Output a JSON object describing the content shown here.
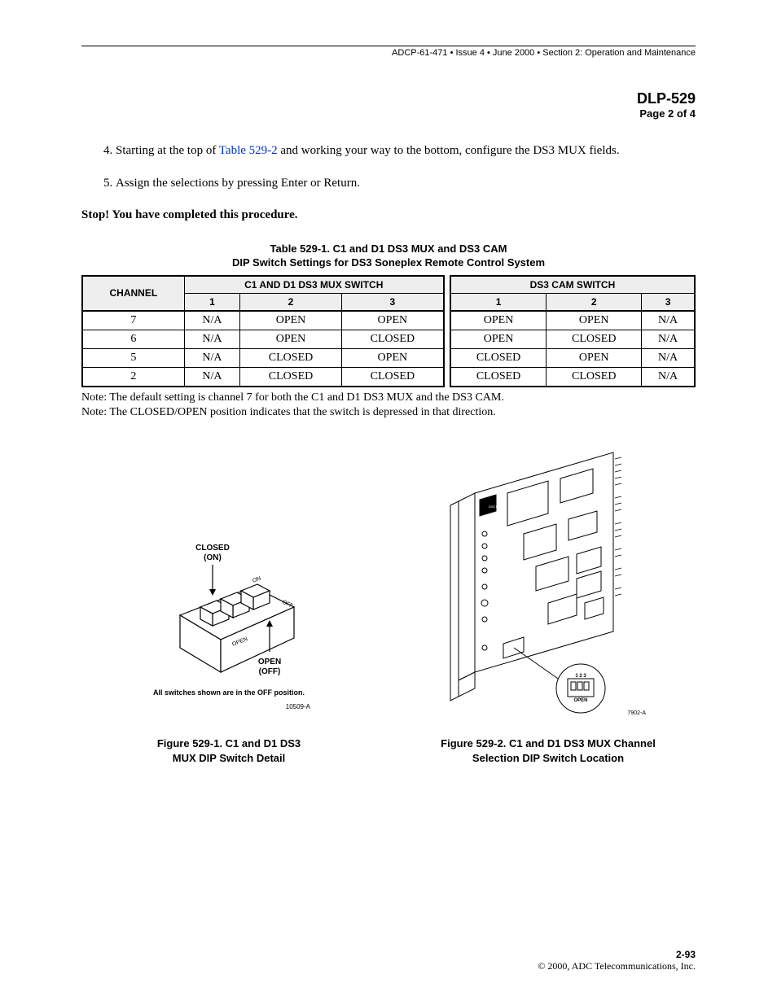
{
  "header": {
    "line": "ADCP-61-471 • Issue 4 • June 2000 • Section 2: Operation and Maintenance"
  },
  "dlp": {
    "title": "DLP-529",
    "page": "Page 2 of 4"
  },
  "steps": {
    "s4_pre": "Starting at the top of ",
    "s4_link": "Table 529-2",
    "s4_post": " and working your way to the bottom, configure the DS3 MUX fields.",
    "s5": "Assign the selections by pressing Enter or Return."
  },
  "stop": "Stop! You have completed this procedure.",
  "table": {
    "title1": "Table 529-1. C1 and D1 DS3 MUX and DS3 CAM",
    "title2": "DIP Switch Settings for DS3 Soneplex Remote Control System",
    "h_channel": "CHANNEL",
    "h_mux": "C1 AND D1 DS3 MUX SWITCH",
    "h_cam": "DS3 CAM SWITCH",
    "h1": "1",
    "h2": "2",
    "h3": "3",
    "rows": [
      {
        "ch": "7",
        "m1": "N/A",
        "m2": "OPEN",
        "m3": "OPEN",
        "c1": "OPEN",
        "c2": "OPEN",
        "c3": "N/A"
      },
      {
        "ch": "6",
        "m1": "N/A",
        "m2": "OPEN",
        "m3": "CLOSED",
        "c1": "OPEN",
        "c2": "CLOSED",
        "c3": "N/A"
      },
      {
        "ch": "5",
        "m1": "N/A",
        "m2": "CLOSED",
        "m3": "OPEN",
        "c1": "CLOSED",
        "c2": "OPEN",
        "c3": "N/A"
      },
      {
        "ch": "2",
        "m1": "N/A",
        "m2": "CLOSED",
        "m3": "CLOSED",
        "c1": "CLOSED",
        "c2": "CLOSED",
        "c3": "N/A"
      }
    ]
  },
  "notes": {
    "n1": "Note: The default setting is channel 7 for both the C1 and D1 DS3 MUX and the DS3 CAM.",
    "n2": "Note: The CLOSED/OPEN position indicates that the switch is depressed in that direction."
  },
  "fig1": {
    "closed": "CLOSED",
    "on": "(ON)",
    "open_lbl": "OPEN",
    "off": "(OFF)",
    "note": "All switches shown are in the OFF position.",
    "code": "10509-A",
    "caption1": "Figure 529-1. C1 and D1 DS3",
    "caption2": "MUX DIP Switch Detail"
  },
  "fig2": {
    "code": "7902-A",
    "caption1": "Figure 529-2. C1 and D1 DS3 MUX Channel",
    "caption2": "Selection DIP Switch Location",
    "dip_label_open": "OPEN",
    "dip_nums": "1 2 3"
  },
  "footer": {
    "pg": "2-93",
    "copy": "© 2000, ADC Telecommunications, Inc."
  }
}
